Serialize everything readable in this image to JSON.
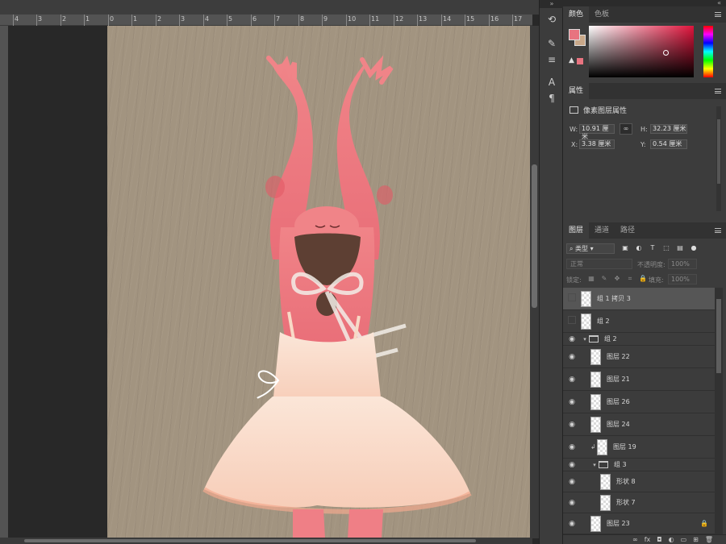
{
  "ruler": {
    "labels": [
      "4",
      "3",
      "2",
      "1",
      "0",
      "1",
      "2",
      "3",
      "4",
      "5",
      "6",
      "7",
      "8",
      "9",
      "10",
      "11",
      "12",
      "13",
      "14",
      "15",
      "16",
      "17"
    ]
  },
  "panels": {
    "color": {
      "tabs": [
        "颜色",
        "色板"
      ],
      "foreground_color": "#e87480",
      "background_color": "#c9a889"
    },
    "properties": {
      "tab": "属性",
      "header": "像素图层属性",
      "w_label": "W:",
      "w_value": "10.91 厘米",
      "h_label": "H:",
      "h_value": "32.23 厘米",
      "x_label": "X:",
      "x_value": "3.38 厘米",
      "y_label": "Y:",
      "y_value": "0.54 厘米"
    },
    "layers": {
      "tabs": [
        "图层",
        "通道",
        "路径"
      ],
      "kind_filter": "类型",
      "blend_mode": "正常",
      "opacity_label": "不透明度:",
      "opacity_value": "100%",
      "lock_label": "锁定:",
      "fill_label": "填充:",
      "fill_value": "100%",
      "items": [
        {
          "name": "组 1 拷贝 3",
          "visible": false,
          "kind": "layer",
          "selected": true
        },
        {
          "name": "组 2",
          "visible": false,
          "kind": "layer"
        },
        {
          "name": "组 2",
          "visible": true,
          "kind": "group"
        },
        {
          "name": "图层 22",
          "visible": true,
          "kind": "layer"
        },
        {
          "name": "图层 21",
          "visible": true,
          "kind": "layer"
        },
        {
          "name": "图层 26",
          "visible": true,
          "kind": "layer"
        },
        {
          "name": "图层 24",
          "visible": true,
          "kind": "layer"
        },
        {
          "name": "图层 19",
          "visible": true,
          "kind": "layer",
          "clipped": true
        },
        {
          "name": "组 3",
          "visible": true,
          "kind": "group"
        },
        {
          "name": "形状 8",
          "visible": true,
          "kind": "shape"
        },
        {
          "name": "形状 7",
          "visible": true,
          "kind": "shape"
        },
        {
          "name": "图层 23",
          "visible": true,
          "kind": "layer",
          "locked": true
        }
      ]
    }
  }
}
